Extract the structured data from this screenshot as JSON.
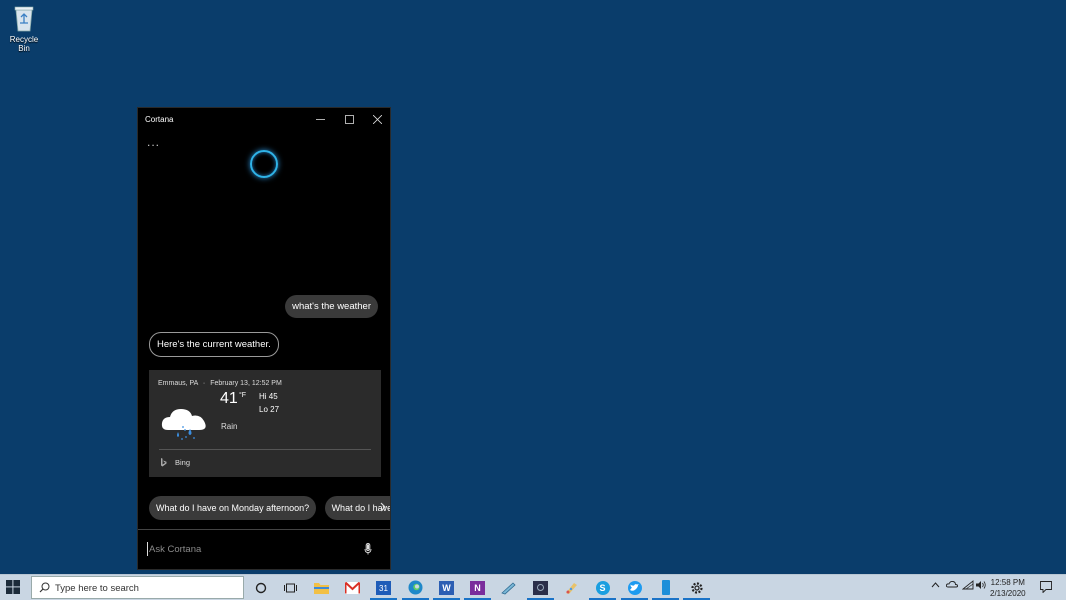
{
  "desktop": {
    "recycle_bin_label": "Recycle Bin"
  },
  "cortana": {
    "window_title": "Cortana",
    "more_label": "...",
    "user_message": "what's the weather",
    "bot_message": "Here's the current weather.",
    "weather": {
      "location": "Emmaus, PA",
      "separator": "·",
      "datetime": "February 13, 12:52 PM",
      "temperature": "41",
      "unit": "°F",
      "hi": "Hi 45",
      "lo": "Lo 27",
      "condition": "Rain",
      "icon": "rain-cloud-icon",
      "source": "Bing"
    },
    "suggestions": [
      "What do I have on Monday afternoon?",
      "What do I have on Tuesday?"
    ],
    "ask_placeholder": "Ask Cortana",
    "accent_color": "#2fb3e8"
  },
  "taskbar": {
    "search_placeholder": "Type here to search",
    "clock_time": "12:58 PM",
    "clock_date": "2/13/2020",
    "calendar_day": "31",
    "pinned_icons": [
      "cortana-circle-icon",
      "task-view-icon",
      "file-explorer-icon",
      "gmail-icon",
      "calendar-icon",
      "edge-icon",
      "word-icon",
      "onenote-icon",
      "snip-icon",
      "app-icon",
      "paint-icon",
      "skype-icon",
      "twitter-icon",
      "phone-icon",
      "settings-icon"
    ],
    "background_color": "#c9d6e3"
  }
}
